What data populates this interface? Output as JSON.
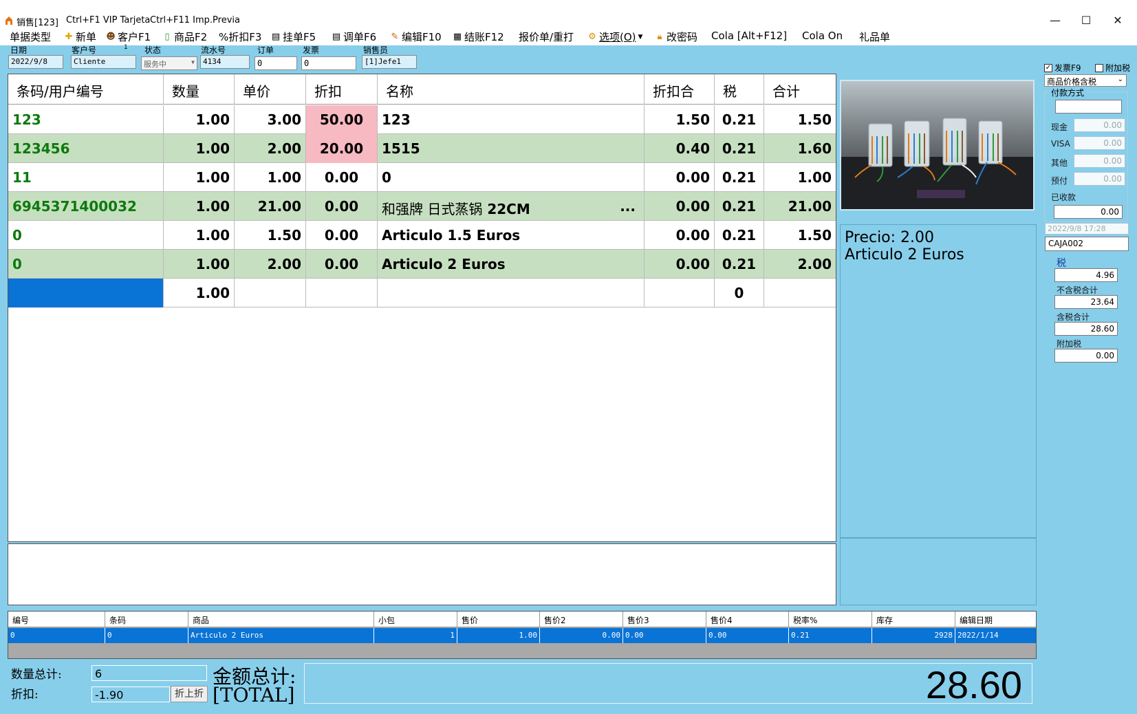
{
  "titlebar": {
    "window_title": "销售[123]",
    "hint1": "Ctrl+F1 VIP Tarjeta",
    "hint2": "Ctrl+F11 Imp.Previa",
    "minimize": "—",
    "maximize": "☐",
    "close": "✕"
  },
  "menu": {
    "doc_type": "单据类型",
    "new": "新单",
    "customer": "客户F1",
    "product": "商品F2",
    "discount": "%折扣F3",
    "hold": "挂单F5",
    "recall": "调单F6",
    "edit": "编辑F10",
    "checkout": "结账F12",
    "quote": "报价单/重打",
    "options": "选项(O)",
    "password": "改密码",
    "cola": "Cola [Alt+F12]",
    "cola_on": "Cola On",
    "gift": "礼品单"
  },
  "header": {
    "date_label": "日期",
    "date_value": "2022/9/8",
    "customer_label": "客户号",
    "customer_marker": "1",
    "customer_value": "Cliente",
    "status_label": "状态",
    "status_value": "服务中",
    "serial_label": "流水号",
    "serial_value": "4134",
    "order_label": "订单",
    "order_value": "0",
    "invoice_label": "发票",
    "invoice_value": "0",
    "seller_label": "销售员",
    "seller_value": "[1]Jefe1"
  },
  "grid": {
    "columns": [
      "条码/用户编号",
      "数量",
      "单价",
      "折扣",
      "名称",
      "折扣合",
      "税",
      "合计"
    ],
    "rows": [
      {
        "code": "123",
        "qty": "1.00",
        "price": "3.00",
        "disc": "50.00",
        "name": "123",
        "disc_total": "1.50",
        "tax": "0.21",
        "total": "1.50"
      },
      {
        "code": "123456",
        "qty": "1.00",
        "price": "2.00",
        "disc": "20.00",
        "name": "1515",
        "disc_total": "0.40",
        "tax": "0.21",
        "total": "1.60"
      },
      {
        "code": "11",
        "qty": "1.00",
        "price": "1.00",
        "disc": "0.00",
        "name": "0",
        "disc_total": "0.00",
        "tax": "0.21",
        "total": "1.00"
      },
      {
        "code": "6945371400032",
        "qty": "1.00",
        "price": "21.00",
        "disc": "0.00",
        "name_cjk": "和强牌 日式蒸锅",
        "name": "22CM",
        "name_more": "...",
        "disc_total": "0.00",
        "tax": "0.21",
        "total": "21.00"
      },
      {
        "code": "0",
        "qty": "1.00",
        "price": "1.50",
        "disc": "0.00",
        "name": "Articulo 1.5 Euros",
        "disc_total": "0.00",
        "tax": "0.21",
        "total": "1.50"
      },
      {
        "code": "0",
        "qty": "1.00",
        "price": "2.00",
        "disc": "0.00",
        "name": "Articulo 2 Euros",
        "disc_total": "0.00",
        "tax": "0.21",
        "total": "2.00"
      }
    ],
    "entry_row": {
      "qty": "1.00",
      "tax": "0"
    }
  },
  "info": {
    "price_line": "Precio: 2.00",
    "name_line": "Articulo 2 Euros"
  },
  "right_panel": {
    "invoice_check": "发票F9",
    "addtax_check": "附加税",
    "price_mode": "商品价格含税",
    "payment_legend": "付款方式",
    "cash_label": "现金",
    "cash_value": "0.00",
    "visa_label": "VISA",
    "visa_value": "0.00",
    "other_label": "其他",
    "other_value": "0.00",
    "prepaid_label": "预付",
    "prepaid_value": "0.00",
    "received_label": "已收款",
    "received_value": "0.00",
    "datetime": "2022/9/8 17:28",
    "register": "CAJA002",
    "tax_label": "税",
    "tax_value": "4.96",
    "pretax_label": "不含税合计",
    "pretax_value": "23.64",
    "aftertax_label": "含税合计",
    "aftertax_value": "28.60",
    "surcharge_label": "附加税",
    "surcharge_value": "0.00"
  },
  "bottom_grid": {
    "columns": [
      "编号",
      "条码",
      "商品",
      "小包",
      "售价",
      "售价2",
      "售价3",
      "售价4",
      "税率%",
      "库存",
      "编辑日期"
    ],
    "row": [
      "0",
      "0",
      "Articulo 2 Euros",
      "1",
      "1.00",
      "0.00",
      "0.00",
      "0.00",
      "0.21",
      "2928",
      "2022/1/14"
    ]
  },
  "summary": {
    "qty_label": "数量总计:",
    "qty_value": "6",
    "disc_label": "折扣:",
    "disc_value": "-1.90",
    "disc_button": "折上折",
    "amount_label": "金额总计:",
    "amount_sub": "[TOTAL]",
    "total_value": "28.60"
  },
  "colors": {
    "workspace": "#87ceeb",
    "row_alt": "#c7dfc1",
    "discount_highlight": "#f7b9c2",
    "selection": "#0a73d6",
    "code_text": "#0d7a0d"
  }
}
